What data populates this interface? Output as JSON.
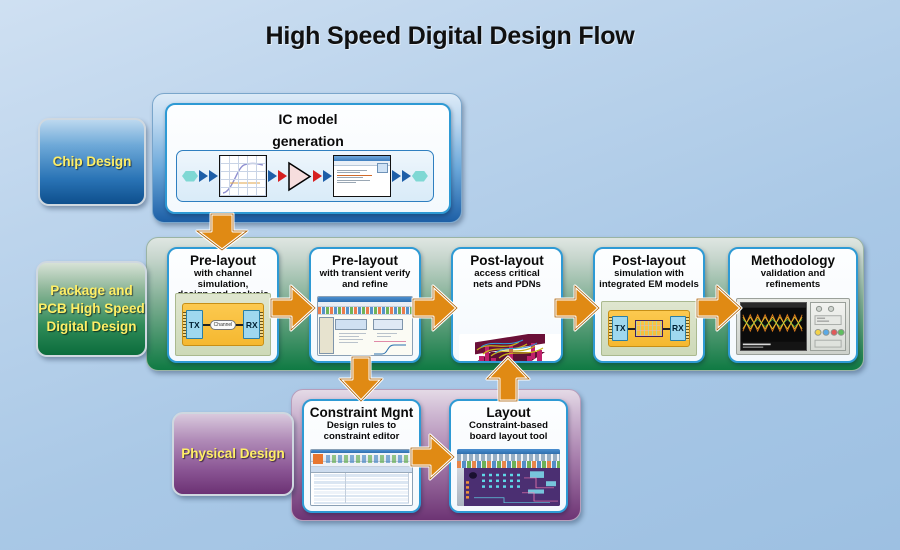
{
  "title": "High Speed Digital Design Flow",
  "categories": [
    {
      "id": "chip",
      "label": "Chip Design",
      "color": "#1d5fa6"
    },
    {
      "id": "pcb",
      "label": "Package and\nPCB High Speed\nDigital Design",
      "color": "#0f7a43"
    },
    {
      "id": "physical",
      "label": "Physical Design",
      "color": "#6d3474"
    }
  ],
  "rows": {
    "chip": {
      "card": {
        "title": "IC model",
        "title2": "generation",
        "flow_steps": [
          "input-node",
          "response-graph",
          "amplifier",
          "model-document",
          "output-node"
        ]
      }
    },
    "pcb": {
      "cards": [
        {
          "title": "Pre-layout",
          "subtitle": "with channel simulation,\ndesign and analysis",
          "image": "tx-channel-rx-board"
        },
        {
          "title": "Pre-layout",
          "subtitle": "with transient verify\nand refine",
          "image": "simulation-software-window"
        },
        {
          "title": "Post-layout",
          "subtitle": "access critical\nnets and PDNs",
          "image": "pdn-via-stackup"
        },
        {
          "title": "Post-layout",
          "subtitle": "simulation with\nintegrated EM models",
          "image": "tx-em-rx-board"
        },
        {
          "title": "Methodology",
          "subtitle": "validation and\nrefinements",
          "image": "oscilloscope-eye-diagram"
        }
      ]
    },
    "physical": {
      "cards": [
        {
          "title": "Constraint Mgnt",
          "subtitle": "Design rules to\nconstraint editor",
          "image": "constraint-editor-window"
        },
        {
          "title": "Layout",
          "subtitle": "Constraint-based\nboard layout tool",
          "image": "board-layout-tool-window"
        }
      ]
    }
  },
  "board_labels": {
    "tx": "TX",
    "rx": "RX",
    "channel": "Channel"
  },
  "colors": {
    "arrow_orange": "#e08a14",
    "arrow_outline": "#ffffff",
    "card_border": "#2e9ad4",
    "category_text": "#ffef66",
    "background_top": "#cfe0f2",
    "background_bottom": "#9dc0e2"
  }
}
